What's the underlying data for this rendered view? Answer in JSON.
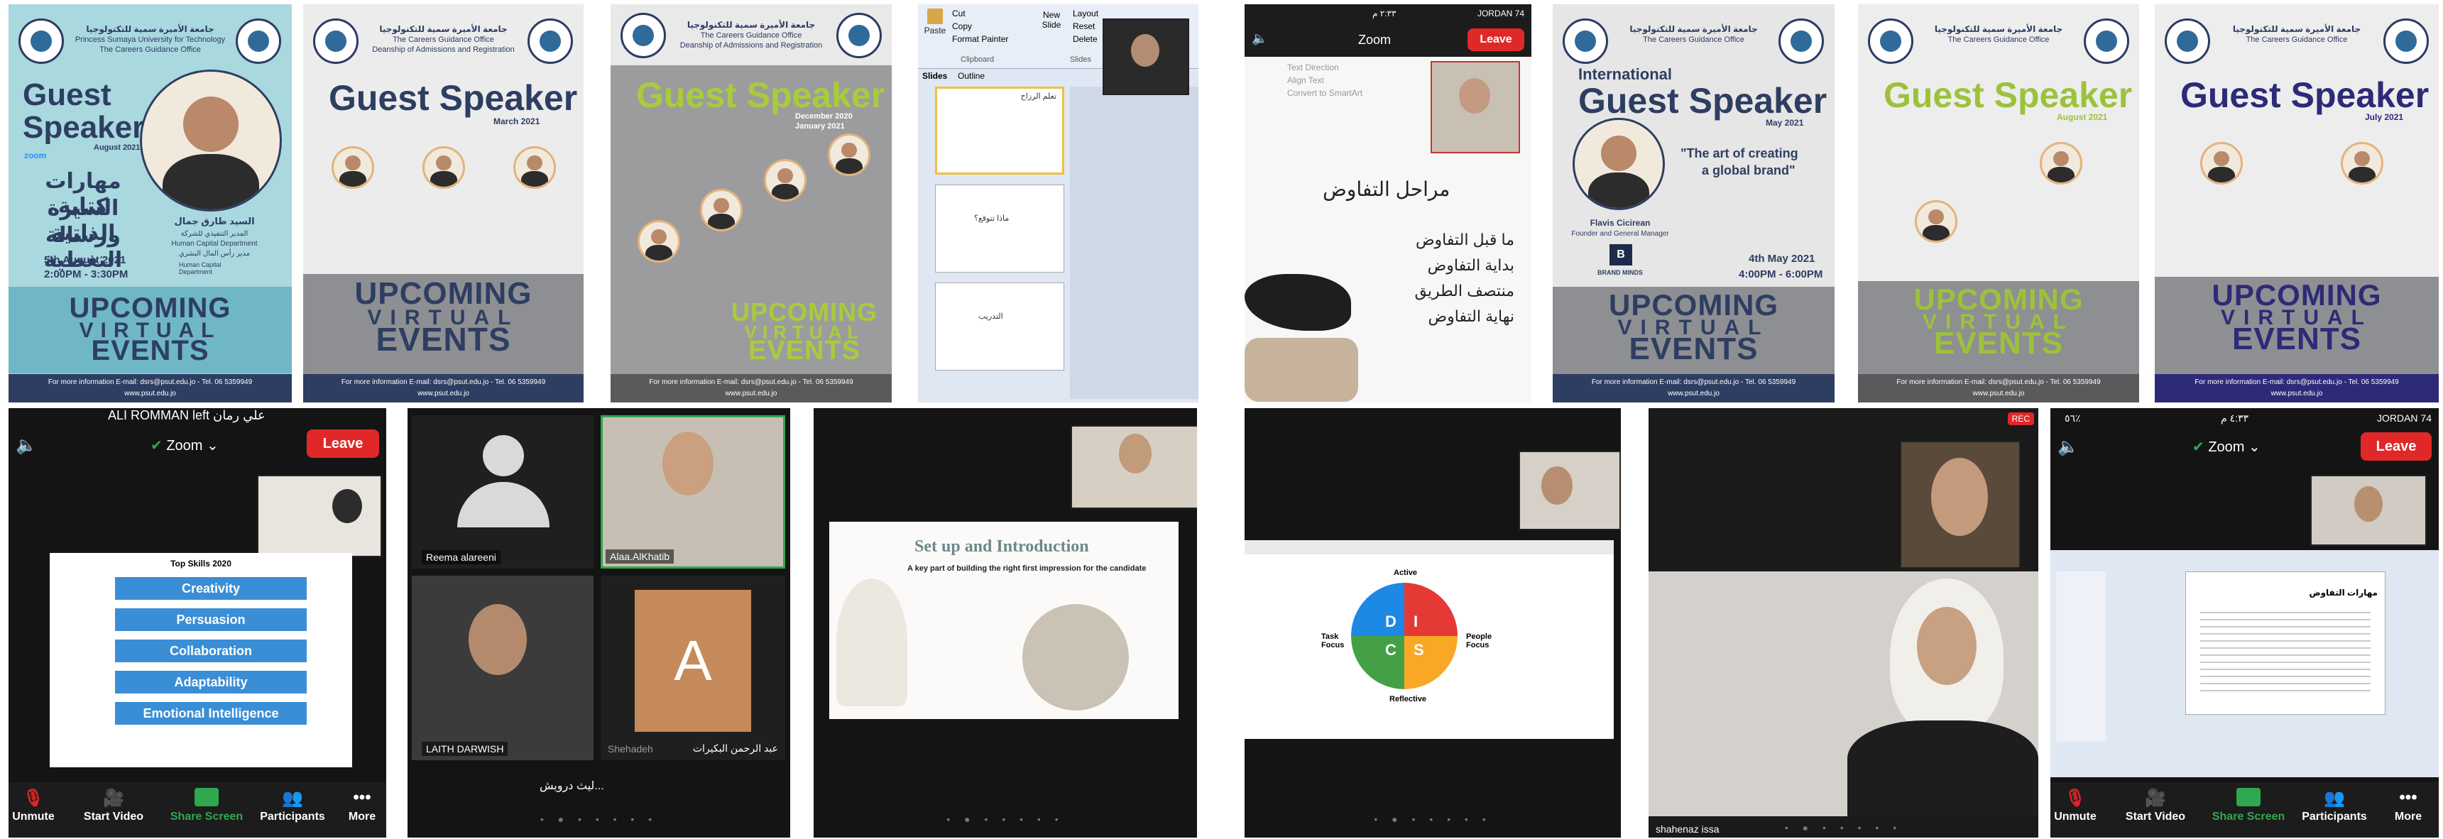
{
  "posters": {
    "uni_ar": "جامعة الأميرة سمية للتكنولوجيا",
    "uni_en": "Princess Sumaya University for Technology",
    "office": "The Careers Guidance Office",
    "deanship": "Deanship of Admissions and Registration",
    "guest": "Guest",
    "speaker": "Speaker",
    "guest_speaker": "Guest Speaker",
    "upcoming": "UPCOMING",
    "virtual": "VIRTUAL",
    "events": "EVENTS",
    "footer_info": "For more information E-mail: dsrs@psut.edu.jo - Tel. 06 5359949",
    "footer_web": "www.psut.edu.jo",
    "p1": {
      "date_label": "August 2021",
      "ar_title_1": "مهارات كتابة",
      "ar_title_2": "السيرة الذاتية",
      "ar_title_3": "ورسالة التغطية",
      "speaker_ar": "السيد طارق جمال",
      "role_ar": "المدير التنفيذي للشركة",
      "department": "Human Capital Department",
      "role2_ar": "مدير رأس المال البشري",
      "event_date": "5th August 2021",
      "event_time": "2:00PM - 3:30PM",
      "zoom": "zoom",
      "dept_logo": "Human Capital Department"
    },
    "p2": {
      "date_label": "March 2021"
    },
    "p3": {
      "date_label_1": "December 2020",
      "date_label_2": "January 2021"
    },
    "p5": {
      "intl": "International",
      "date_label": "May 2021",
      "quote_1": "\"The art of creating",
      "quote_2": "a global brand\"",
      "speaker": "Flavis Cicirean",
      "role": "Founder and General Manager",
      "brand": "BRAND MINDS",
      "event_date": "4th May 2021",
      "event_time": "4:00PM - 6:00PM"
    },
    "p6": {
      "date_label": "August 2021"
    },
    "p7": {
      "date_label": "July 2021"
    }
  },
  "ppt": {
    "menu_paste": "Paste",
    "menu_cut": "Cut",
    "menu_copy": "Copy",
    "menu_format": "Format Painter",
    "menu_new": "New",
    "menu_slide": "Slide",
    "menu_layout": "Layout",
    "menu_reset": "Reset",
    "menu_delete": "Delete",
    "group_clipboard": "Clipboard",
    "group_slides": "Slides",
    "tab_slides": "Slides",
    "tab_outline": "Outline",
    "slide1_title": "تعلم الرزاح",
    "slide2_text": "ماذا تتوقع؟",
    "slide3_text": "التدريب"
  },
  "zoom_top_center": {
    "app": "Zoom",
    "leave": "Leave",
    "menu_text_direction": "Text Direction",
    "menu_align_text": "Align Text",
    "menu_convert": "Convert to SmartArt",
    "slide_title": "مراحل التفاوض",
    "items": [
      "ما قبل التفاوض",
      "بداية التفاوض",
      "منتصف الطريق",
      "نهاية التفاوض"
    ],
    "status_time": "٢:٣٣ م",
    "carrier": "JORDAN 74"
  },
  "zoom_bottom_left": {
    "top_name": "ALI ROMMAN left علي رمان",
    "app": "Zoom",
    "leave": "Leave",
    "slide_title": "Top Skills 2020",
    "skills": [
      "Creativity",
      "Persuasion",
      "Collaboration",
      "Adaptability",
      "Emotional Intelligence"
    ],
    "toolbar": [
      "Unmute",
      "Start Video",
      "Share Screen",
      "Participants",
      "More"
    ]
  },
  "gallery": {
    "name1": "Reema alareeni",
    "name2": "Alaa.AlKhatib",
    "name3": "LAITH DARWISH",
    "name3_ar": "ليث درويش...",
    "name4": "عبد الرحمن البكيرات",
    "name4_partial": "Shehadeh",
    "letter": "A"
  },
  "setup_slide": {
    "title": "Set up and Introduction",
    "subtitle": "A key part of building the right first impression for the candidate"
  },
  "disc": {
    "label_active": "Active",
    "label_task": "Task Focus",
    "label_people": "People Focus",
    "label_reflective": "Reflective",
    "d": "D",
    "i": "I",
    "s": "S",
    "c": "C"
  },
  "rec_view": {
    "rec": "REC",
    "name": "shahenaz issa"
  },
  "zoom_bottom_right": {
    "status_time": "٤:٣٣ م",
    "battery": "٥٦٪",
    "carrier": "JORDAN 74",
    "app": "Zoom",
    "leave": "Leave",
    "slide_title": "مهارات التفاوض",
    "toolbar": [
      "Unmute",
      "Start Video",
      "Share Screen",
      "Participants",
      "More"
    ]
  },
  "colors": {
    "navy": "#2e3e62",
    "teal": "#7bc1cf",
    "grey": "#8e8f92",
    "green": "#9cc23c",
    "zoom_red": "#e02828",
    "zoom_green": "#2fa84f"
  }
}
